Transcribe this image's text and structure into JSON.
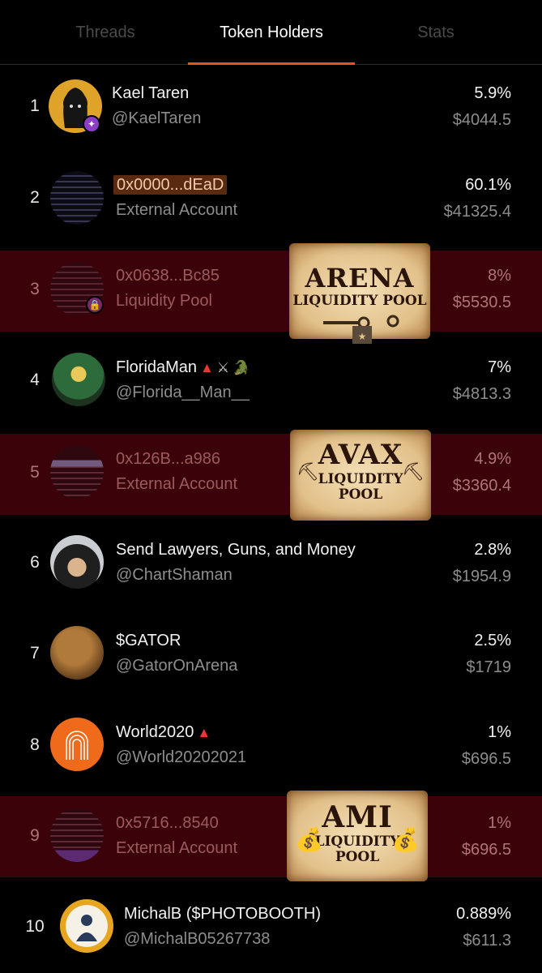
{
  "tabs": [
    {
      "label": "Threads"
    },
    {
      "label": "Token Holders"
    },
    {
      "label": "Stats"
    }
  ],
  "holders": [
    {
      "rank": "1",
      "name": "Kael Taren",
      "handle": "@KaelTaren",
      "percent": "5.9%",
      "value": "$4044.5"
    },
    {
      "rank": "2",
      "name": "0x0000...dEaD",
      "handle": "External Account",
      "percent": "60.1%",
      "value": "$41325.4"
    },
    {
      "rank": "3",
      "name": "0x0638...Bc85",
      "handle": "Liquidity Pool",
      "percent": "8%",
      "value": "$5530.5"
    },
    {
      "rank": "4",
      "name": "FloridaMan",
      "handle": "@Florida__Man__",
      "percent": "7%",
      "value": "$4813.3"
    },
    {
      "rank": "5",
      "name": "0x126B...a986",
      "handle": "External Account",
      "percent": "4.9%",
      "value": "$3360.4"
    },
    {
      "rank": "6",
      "name": "Send Lawyers, Guns, and Money",
      "handle": "@ChartShaman",
      "percent": "2.8%",
      "value": "$1954.9"
    },
    {
      "rank": "7",
      "name": "$GATOR",
      "handle": "@GatorOnArena",
      "percent": "2.5%",
      "value": "$1719"
    },
    {
      "rank": "8",
      "name": "World2020",
      "handle": "@World20202021",
      "percent": "1%",
      "value": "$696.5"
    },
    {
      "rank": "9",
      "name": "0x5716...8540",
      "handle": "External Account",
      "percent": "1%",
      "value": "$696.5"
    },
    {
      "rank": "10",
      "name": "MichalB ($PHOTOBOOTH)",
      "handle": "@MichalB05267738",
      "percent": "0.889%",
      "value": "$611.3"
    }
  ],
  "signs": [
    {
      "title": "ARENA",
      "line1": "LIQUIDITY POOL",
      "line2": ""
    },
    {
      "title": "AVAX",
      "line1": "LIQUIDITY",
      "line2": "POOL"
    },
    {
      "title": "AMI",
      "line1": "LIQUIDITY",
      "line2": "POOL"
    }
  ],
  "colors": {
    "accent": "#e0571d",
    "highlight_row": "#3b0309",
    "background": "#000000"
  }
}
